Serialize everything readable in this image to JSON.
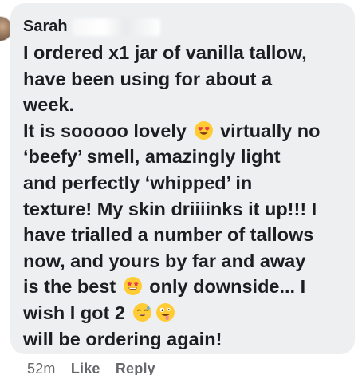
{
  "comment": {
    "author": "Sarah",
    "lines": [
      "I ordered x1 jar of vanilla tallow,",
      "have been using for about a",
      "week.",
      "It is sooooo lovely",
      "virtually no",
      "‘beefy’ smell, amazingly light",
      "and perfectly ‘whipped’ in",
      "texture! My skin driiiinks it up!!! I",
      "have trialled a number of tallows",
      "now, and yours by far and away",
      "is the best",
      "only downside... I",
      "wish I got 2",
      "will be ordering again!"
    ],
    "emojis": {
      "heart_eyes": "heart-eyes-emoji",
      "star_struck": "star-struck-emoji",
      "sweat_smile": "sweat-smile-emoji",
      "zany_face": "zany-face-emoji"
    }
  },
  "footer": {
    "time": "52m",
    "like": "Like",
    "reply": "Reply"
  },
  "colors": {
    "bubble": "#eeeff1",
    "text": "#1c1e21",
    "muted": "#65676b",
    "emoji_yellow": "#ffcc33",
    "heart_red": "#e8374a"
  }
}
